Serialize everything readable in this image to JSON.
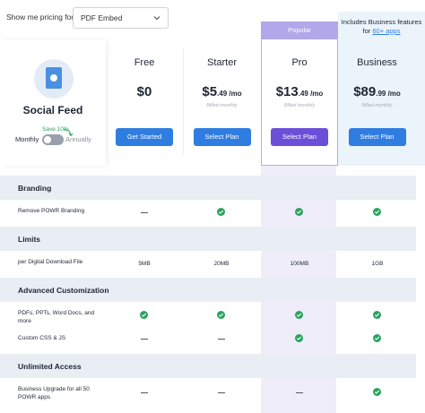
{
  "top": {
    "label": "Show me pricing for:",
    "selected_product": "PDF Embed"
  },
  "app": {
    "name": "Social Feed",
    "icon": "pdf-document-icon",
    "save_note": "Save 10%",
    "monthly_label": "Monthly",
    "annually_label": "Annually"
  },
  "popular_label": "Popular",
  "business_note_prefix": "Includes Business features for ",
  "business_note_link": "60+ apps",
  "plans": [
    {
      "name": "Free",
      "price_main": "$0",
      "price_cents": "",
      "billed": "",
      "button": "Get Started"
    },
    {
      "name": "Starter",
      "price_main": "$5",
      "price_cents": ".49 /mo",
      "billed": "Billed monthly",
      "button": "Select Plan"
    },
    {
      "name": "Pro",
      "price_main": "$13",
      "price_cents": ".49 /mo",
      "billed": "Billed monthly",
      "button": "Select Plan"
    },
    {
      "name": "Business",
      "price_main": "$89",
      "price_cents": ".99 /mo",
      "billed": "Billed monthly",
      "button": "Select Plan"
    }
  ],
  "sections": [
    {
      "title": "Branding",
      "rows": [
        {
          "feature": "Remove POWR Branding",
          "values": [
            "dash",
            "check",
            "check",
            "check"
          ]
        }
      ]
    },
    {
      "title": "Limits",
      "rows": [
        {
          "feature": "per Digital Download File",
          "values": [
            "5MB",
            "20MB",
            "100MB",
            "1GB"
          ]
        }
      ]
    },
    {
      "title": "Advanced Customization",
      "rows": [
        {
          "feature": "PDFs, PPTs, Word Docs, and more",
          "values": [
            "check",
            "check",
            "check",
            "check"
          ]
        },
        {
          "feature": "Custom CSS & JS",
          "values": [
            "dash",
            "dash",
            "check",
            "check"
          ]
        }
      ]
    },
    {
      "title": "Unlimited Access",
      "rows": [
        {
          "feature": "Business Upgrade for all 50 POWR apps",
          "values": [
            "dash",
            "dash",
            "dash",
            "check"
          ]
        }
      ]
    }
  ],
  "colors": {
    "accent_blue": "#2f7de1",
    "pro_purple": "#6c4fd8",
    "check_green": "#2aa35e"
  }
}
